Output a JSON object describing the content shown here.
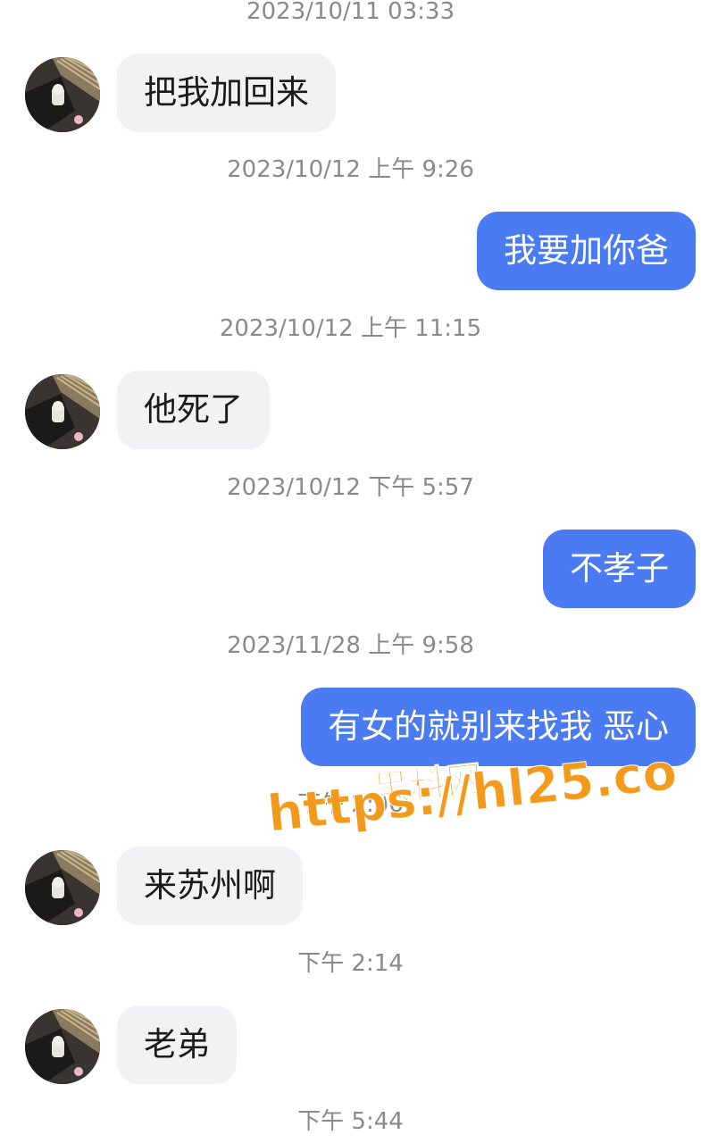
{
  "messages": [
    {
      "timestamp": "2023/10/11 03:33"
    },
    {
      "text": "把我加回来"
    },
    {
      "timestamp": "2023/10/12 上午 9:26"
    },
    {
      "text": "我要加你爸"
    },
    {
      "timestamp": "2023/10/12 上午 11:15"
    },
    {
      "text": "他死了"
    },
    {
      "timestamp": "2023/10/12 下午 5:57"
    },
    {
      "text": "不孝子"
    },
    {
      "timestamp": "2023/11/28 上午 9:58"
    },
    {
      "text": "有女的就别来找我 恶心"
    },
    {
      "timestamp": "下午 2:06"
    },
    {
      "text": "来苏州啊"
    },
    {
      "timestamp": "下午 2:14"
    },
    {
      "text": "老弟"
    },
    {
      "timestamp": "下午 5:44"
    }
  ],
  "watermark": {
    "title": "黑料网",
    "url": "https://hl25.co"
  },
  "colors": {
    "outgoing_bubble": "#4a7bf2",
    "incoming_bubble": "#f2f2f4",
    "timestamp_text": "#8a8a8a",
    "watermark": "#f39a1c"
  },
  "icons": {
    "avatar": "contact-avatar"
  }
}
